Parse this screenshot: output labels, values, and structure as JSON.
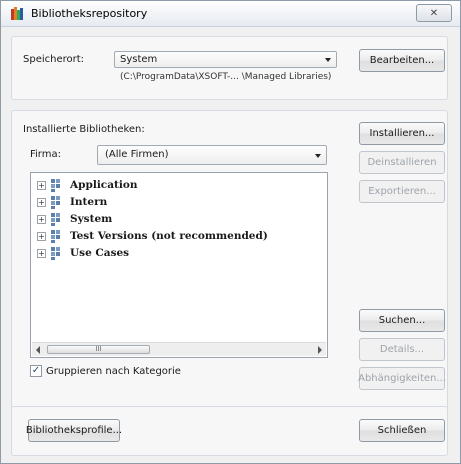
{
  "window": {
    "title": "Bibliotheksrepository",
    "close_glyph": "✕"
  },
  "location": {
    "label": "Speicherort:",
    "selected": "System",
    "path": "(C:\\ProgramData\\XSOFT-... \\Managed Libraries)",
    "edit_button": "Bearbeiten..."
  },
  "installed": {
    "label": "Installierte Bibliotheken:",
    "company_label": "Firma:",
    "company_selected": "(Alle Firmen)",
    "tree_items": [
      {
        "label": "Application"
      },
      {
        "label": "Intern"
      },
      {
        "label": "System"
      },
      {
        "label": "Test Versions (not recommended)"
      },
      {
        "label": "Use Cases"
      }
    ],
    "scroll_thumb_grip": "III",
    "group_by_category": "Gruppieren nach Kategorie",
    "group_by_category_checked": true
  },
  "buttons": {
    "install": "Installieren...",
    "uninstall": "Deinstallieren",
    "export": "Exportieren...",
    "search": "Suchen...",
    "details": "Details...",
    "dependencies": "Abhängigkeiten...",
    "profiles": "Bibliotheksprofile...",
    "close": "Schließen"
  },
  "icons": {
    "app": "library-books-icon",
    "expander": "plus-expander-icon",
    "folder": "library-category-icon"
  },
  "colors": {
    "window_bg": "#f0f0f0",
    "tree_bg": "#ffffff",
    "disabled_text": "#9ea4aa"
  }
}
